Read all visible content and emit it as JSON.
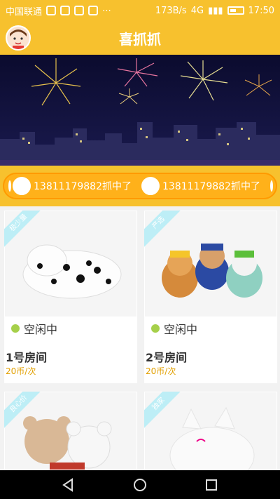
{
  "status_bar": {
    "carrier": "中国联通",
    "speed": "173B/s",
    "time": "17:50",
    "network": "4G"
  },
  "header": {
    "title": "喜抓抓"
  },
  "ticker": {
    "items": [
      {
        "text": "13811179882抓中了"
      },
      {
        "text": "13811179882抓中了"
      }
    ]
  },
  "rooms": [
    {
      "tag": "极少量",
      "status": "空闲中",
      "title": "1号房间",
      "price": "20币/次"
    },
    {
      "tag": "严选",
      "status": "空闲中",
      "title": "2号房间",
      "price": "20币/次"
    },
    {
      "tag": "良心价",
      "status": "",
      "title": "",
      "price": ""
    },
    {
      "tag": "独家",
      "status": "",
      "title": "",
      "price": ""
    }
  ]
}
